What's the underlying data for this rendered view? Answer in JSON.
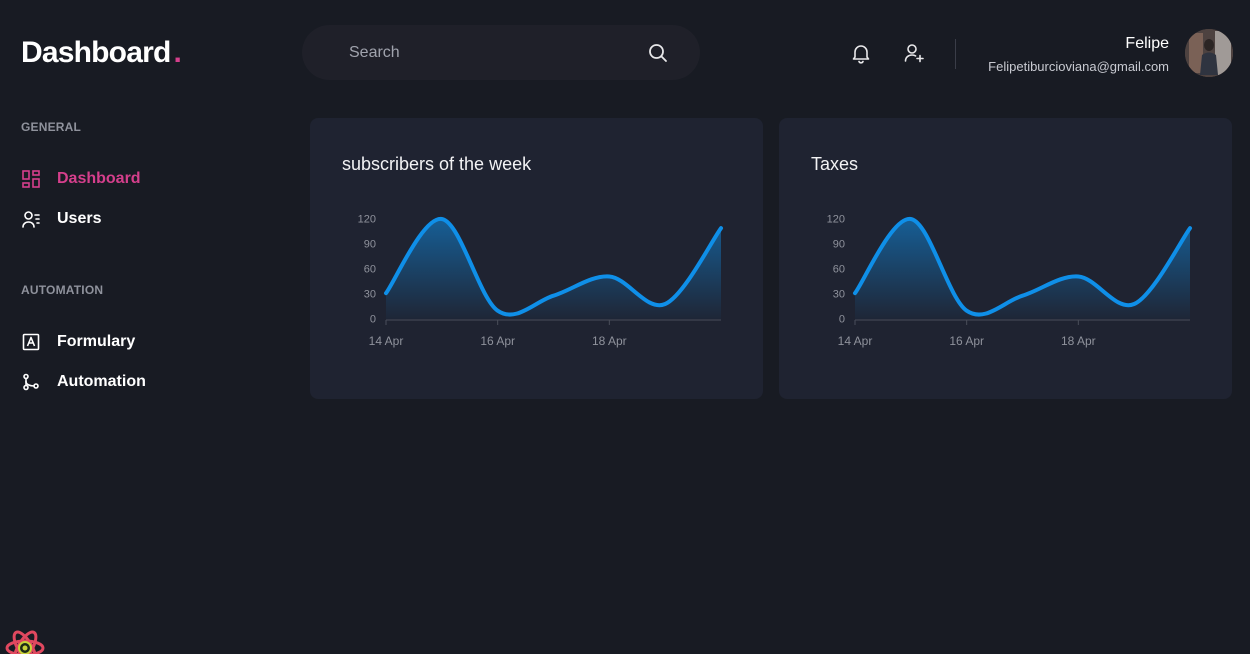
{
  "app": {
    "title": "Dashboard",
    "title_dot": ".",
    "accent_color": "#d53f8c",
    "chart_color": "#0f8fe8"
  },
  "search": {
    "placeholder": "Search",
    "icon": "search-icon"
  },
  "header": {
    "icons": [
      "bell-icon",
      "add-user-icon"
    ],
    "user_name": "Felipe",
    "user_email": "Felipetiburcioviana@gmail.com"
  },
  "sidebar": {
    "sections": [
      {
        "title": "GENERAL",
        "items": [
          {
            "label": "Dashboard",
            "icon": "dashboard-icon",
            "active": true
          },
          {
            "label": "Users",
            "icon": "users-icon",
            "active": false
          }
        ]
      },
      {
        "title": "AUTOMATION",
        "items": [
          {
            "label": "Formulary",
            "icon": "form-icon",
            "active": false
          },
          {
            "label": "Automation",
            "icon": "git-branch-icon",
            "active": false
          }
        ]
      }
    ]
  },
  "cards": [
    {
      "title": "subscribers of the week"
    },
    {
      "title": "Taxes"
    }
  ],
  "chart_data": [
    {
      "type": "area",
      "title": "subscribers of the week",
      "x": [
        "2021-04-14",
        "2021-04-15",
        "2021-04-16",
        "2021-04-17",
        "2021-04-18",
        "2021-04-19",
        "2021-04-20"
      ],
      "x_tick_labels": [
        "14 Apr",
        "16 Apr",
        "18 Apr"
      ],
      "x_tick_positions": [
        "2021-04-14",
        "2021-04-16",
        "2021-04-18"
      ],
      "series": [
        {
          "values": [
            31,
            120,
            10,
            28,
            51,
            18,
            109
          ]
        }
      ],
      "y_ticks": [
        0,
        30,
        60,
        90,
        120
      ],
      "ylim": [
        0,
        120
      ],
      "grid": false
    },
    {
      "type": "area",
      "title": "Taxes",
      "x": [
        "2021-04-14",
        "2021-04-15",
        "2021-04-16",
        "2021-04-17",
        "2021-04-18",
        "2021-04-19",
        "2021-04-20"
      ],
      "x_tick_labels": [
        "14 Apr",
        "16 Apr",
        "18 Apr"
      ],
      "x_tick_positions": [
        "2021-04-14",
        "2021-04-16",
        "2021-04-18"
      ],
      "series": [
        {
          "values": [
            31,
            120,
            10,
            28,
            51,
            18,
            109
          ]
        }
      ],
      "y_ticks": [
        0,
        30,
        60,
        90,
        120
      ],
      "ylim": [
        0,
        120
      ],
      "grid": false
    }
  ]
}
